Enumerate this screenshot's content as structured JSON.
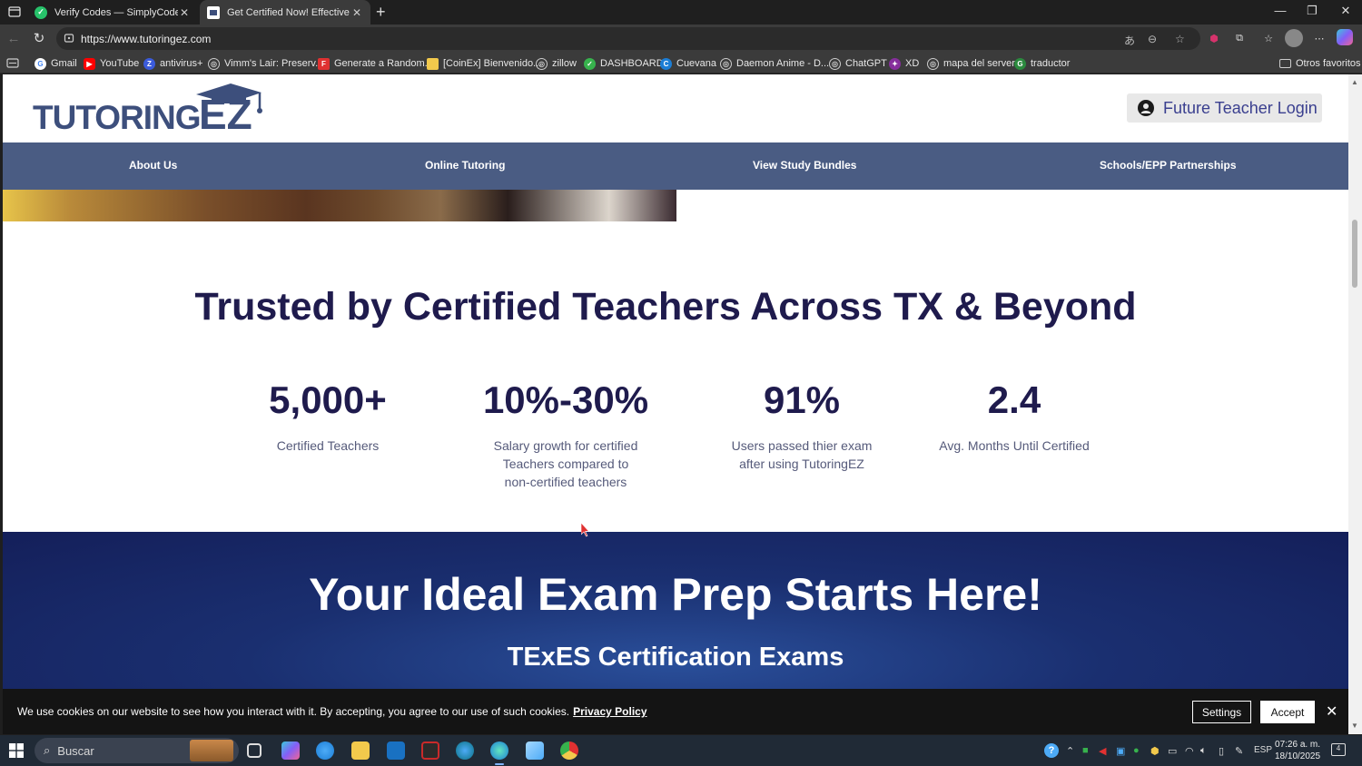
{
  "browser": {
    "tabs": [
      {
        "label": "Verify Codes — SimplyCodes",
        "active": false,
        "favicon_color": "#27c26a"
      },
      {
        "label": "Get Certified Now! Effective Teach",
        "active": true,
        "favicon_color": "#ffffff"
      }
    ],
    "url": "https://www.tutoringez.com",
    "bookmarks": [
      {
        "label": "Gmail",
        "icon": "google-icon",
        "color": "#4285f4",
        "glyph": "G"
      },
      {
        "label": "YouTube",
        "icon": "youtube-icon",
        "color": "#ff0000",
        "glyph": "▶"
      },
      {
        "label": "antivirus+",
        "icon": "antivirus-icon",
        "color": "#3b5bdb",
        "glyph": "Z"
      },
      {
        "label": "Vimm's Lair: Preserv...",
        "icon": "globe-icon",
        "color": "#555555",
        "glyph": "◎"
      },
      {
        "label": "Generate a Random...",
        "icon": "generator-icon",
        "color": "#e03131",
        "glyph": "F"
      },
      {
        "label": "[CoinEx] Bienvenido...",
        "icon": "folder-icon",
        "color": "#f2c94c",
        "glyph": "■"
      },
      {
        "label": "zillow",
        "icon": "globe-icon",
        "color": "#555555",
        "glyph": "◎"
      },
      {
        "label": "DASHBOARD",
        "icon": "dashboard-icon",
        "color": "#37b24d",
        "glyph": "✓"
      },
      {
        "label": "Cuevana",
        "icon": "cuevana-icon",
        "color": "#1c7ed6",
        "glyph": "C"
      },
      {
        "label": "Daemon Anime - D...",
        "icon": "globe-icon",
        "color": "#555555",
        "glyph": "◎"
      },
      {
        "label": "ChatGPT",
        "icon": "globe-icon",
        "color": "#555555",
        "glyph": "◎"
      },
      {
        "label": "XD",
        "icon": "xd-icon",
        "color": "#862e9c",
        "glyph": "✦"
      },
      {
        "label": "mapa del server",
        "icon": "globe-icon",
        "color": "#555555",
        "glyph": "◎"
      },
      {
        "label": "traductor",
        "icon": "translate-icon",
        "color": "#2b8a3e",
        "glyph": "G"
      }
    ],
    "other_bookmarks": "Otros favoritos"
  },
  "site": {
    "logo_text": "TUTORINGEZ",
    "login_label": "Future Teacher Login",
    "nav": [
      "About Us",
      "Online Tutoring",
      "View Study Bundles",
      "Schools/EPP Partnerships"
    ],
    "trust_title": "Trusted by Certified Teachers Across TX & Beyond",
    "stats": [
      {
        "value": "5,000+",
        "label": "Certified Teachers"
      },
      {
        "value": "10%-30%",
        "label": "Salary growth for certified Teachers compared to non-certified teachers"
      },
      {
        "value": "91%",
        "label": "Users passed thier exam after using TutoringEZ"
      },
      {
        "value": "2.4",
        "label": "Avg. Months Until Certified"
      }
    ],
    "exam_title": "Your Ideal Exam Prep Starts Here!",
    "exam_subtitle": "TExES Certification Exams"
  },
  "cookie_banner": {
    "message": "We use cookies on our website to see how you interact with it. By accepting, you agree to our use of such cookies.",
    "privacy_link": "Privacy Policy",
    "settings_label": "Settings",
    "accept_label": "Accept"
  },
  "taskbar": {
    "search_placeholder": "Buscar",
    "language": "ESP",
    "time": "07:26 a. m.",
    "date": "18/10/2025",
    "notification_count": "4"
  },
  "colors": {
    "brand_dark": "#1f1b4d",
    "nav_bg": "#4a5c83",
    "logo_blue": "#3d4f7c"
  }
}
